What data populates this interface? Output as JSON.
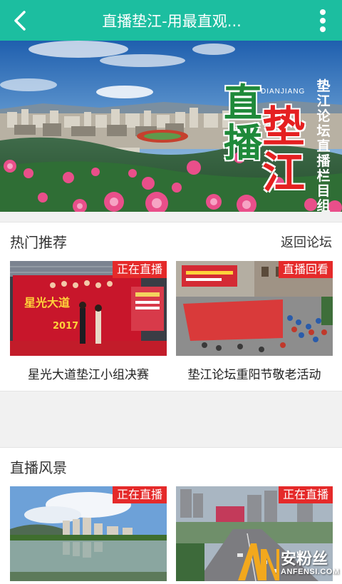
{
  "header": {
    "back_icon": "chevron-left-icon",
    "title": "直播垫江-用最直观...",
    "more_icon": "more-vertical-icon"
  },
  "banner": {
    "title_chars": [
      "直",
      "播",
      "垫",
      "江"
    ],
    "pinyin": "DIANJIANG",
    "vertical_text": "垫江论坛直播栏目组"
  },
  "hot": {
    "heading": "热门推荐",
    "more": "返回论坛",
    "cards": [
      {
        "badge": "正在直播",
        "caption": "星光大道垫江小组决赛",
        "stage_text": "2017"
      },
      {
        "badge": "直播回看",
        "caption": "垫江论坛重阳节敬老活动"
      }
    ]
  },
  "scenery": {
    "heading": "直播风景",
    "cards": [
      {
        "badge": "正在直播"
      },
      {
        "badge": "正在直播"
      }
    ]
  },
  "watermark": {
    "text": "安粉丝",
    "sub": "ANFENSI.COM"
  },
  "colors": {
    "accent": "#1cbea0",
    "badge": "#e52a2a"
  }
}
